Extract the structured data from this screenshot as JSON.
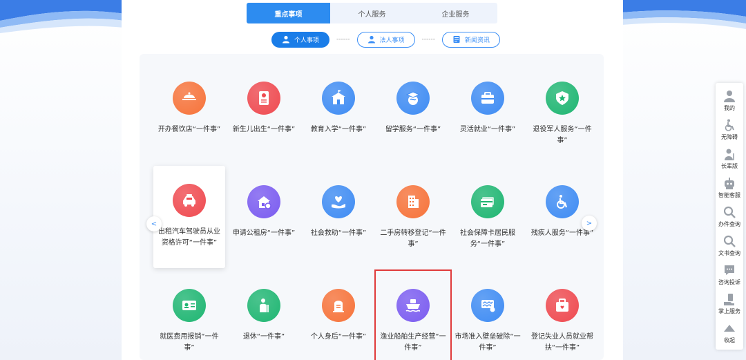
{
  "tabs": [
    {
      "label": "重点事项",
      "active": true
    },
    {
      "label": "个人服务",
      "active": false
    },
    {
      "label": "企业服务",
      "active": false
    }
  ],
  "subtabs": {
    "personal": "个人事项",
    "legal": "法人事项",
    "news": "新闻资讯",
    "separator": "------"
  },
  "nav": {
    "prev": "<",
    "next": ">"
  },
  "services": [
    {
      "label": "开办餐饮店“一件事”",
      "icon": "dining-cloche-icon",
      "color": "#f7733a"
    },
    {
      "label": "新生儿出生“一件事”",
      "icon": "birth-certificate-icon",
      "color": "#ef4a50"
    },
    {
      "label": "教育入学“一件事”",
      "icon": "school-building-icon",
      "color": "#3f8cf3"
    },
    {
      "label": "留学服务“一件事”",
      "icon": "graduation-globe-icon",
      "color": "#3f8cf3"
    },
    {
      "label": "灵活就业“一件事”",
      "icon": "briefcase-icon",
      "color": "#3f8cf3"
    },
    {
      "label": "退役军人服务“一件事”",
      "icon": "military-badge-icon",
      "color": "#1fb672"
    },
    {
      "label": "出租汽车驾驶员从业资格许可“一件事”",
      "icon": "taxi-icon",
      "color": "#ef4a50"
    },
    {
      "label": "申请公租房“一件事”",
      "icon": "public-housing-icon",
      "color": "#7b5cf0"
    },
    {
      "label": "社会救助“一件事”",
      "icon": "helping-hand-heart-icon",
      "color": "#3f8cf3"
    },
    {
      "label": "二手房转移登记“一件事”",
      "icon": "apartment-building-icon",
      "color": "#f7733a"
    },
    {
      "label": "社会保障卡居民服务“一件事”",
      "icon": "social-security-card-icon",
      "color": "#1fb672"
    },
    {
      "label": "残疾人服务“一件事”",
      "icon": "wheelchair-icon",
      "color": "#3f8cf3"
    },
    {
      "label": "就医费用报销“一件事”",
      "icon": "medical-card-icon",
      "color": "#1fb672"
    },
    {
      "label": "退休“一件事”",
      "icon": "elderly-person-icon",
      "color": "#1fb672"
    },
    {
      "label": "个人身后“一件事”",
      "icon": "tombstone-icon",
      "color": "#f7733a"
    },
    {
      "label": "渔业船舶生产经营“一件事”",
      "icon": "fishing-ship-icon",
      "color": "#7b5cf0"
    },
    {
      "label": "市场准入壁垒破除“一件事”",
      "icon": "market-barrier-icon",
      "color": "#3f8cf3"
    },
    {
      "label": "登记失业人员就业帮扶“一件事”",
      "icon": "medical-kit-icon",
      "color": "#ef4a50"
    }
  ],
  "sidebar": [
    {
      "label": "我的",
      "icon": "user-icon"
    },
    {
      "label": "无障碍",
      "icon": "accessibility-icon"
    },
    {
      "label": "长辈版",
      "icon": "elder-mode-icon"
    },
    {
      "label": "智能客服",
      "icon": "robot-service-icon"
    },
    {
      "label": "办件查询",
      "icon": "search-icon"
    },
    {
      "label": "文书查询",
      "icon": "document-search-icon"
    },
    {
      "label": "咨询投诉",
      "icon": "chat-bubble-icon"
    },
    {
      "label": "掌上服务",
      "icon": "mobile-hand-icon"
    },
    {
      "label": "收起",
      "icon": "collapse-up-icon"
    }
  ]
}
